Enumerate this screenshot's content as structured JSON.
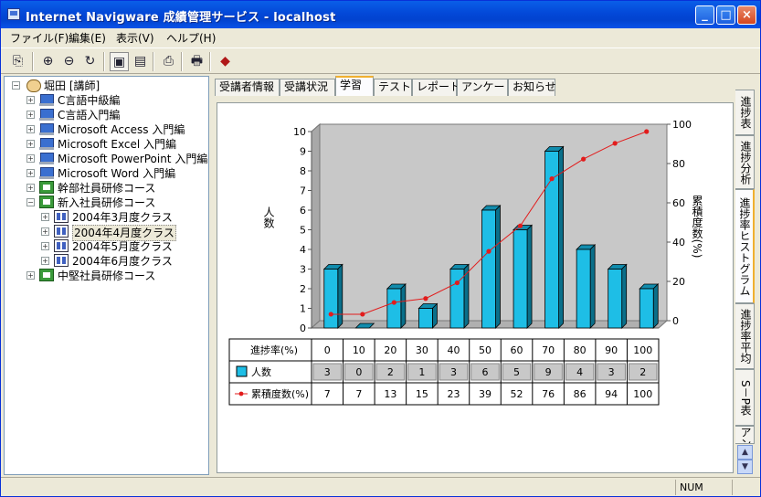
{
  "window": {
    "title": "Internet Navigware 成績管理サービス - localhost",
    "buttons": {
      "minimize": "_",
      "maximize": "□",
      "close": "×"
    }
  },
  "menu": [
    "ファイル(F)",
    "編集(E)",
    "表示(V)",
    "ヘルプ(H)"
  ],
  "toolbar": {
    "icons": [
      "connect-icon",
      "zoom-in-icon",
      "zoom-out-icon",
      "refresh-icon",
      "view-mode-a-icon",
      "view-mode-b-icon",
      "report-icon",
      "print-icon",
      "book-icon"
    ]
  },
  "tree": {
    "root": "堀田 [講師]",
    "items": [
      {
        "label": "C言語中級編",
        "type": "course",
        "expander": "+"
      },
      {
        "label": "C言語入門編",
        "type": "course",
        "expander": "+"
      },
      {
        "label": "Microsoft Access 入門編",
        "type": "course",
        "expander": "+"
      },
      {
        "label": "Microsoft Excel 入門編",
        "type": "course",
        "expander": "+"
      },
      {
        "label": "Microsoft PowerPoint 入門編",
        "type": "course",
        "expander": "+"
      },
      {
        "label": "Microsoft Word 入門編",
        "type": "course",
        "expander": "+"
      },
      {
        "label": "幹部社員研修コース",
        "type": "group",
        "expander": "+"
      },
      {
        "label": "新入社員研修コース",
        "type": "group",
        "expander": "−"
      },
      {
        "label": "2004年3月度クラス",
        "type": "class",
        "expander": "+"
      },
      {
        "label": "2004年4月度クラス",
        "type": "class",
        "expander": "+",
        "selected": true
      },
      {
        "label": "2004年5月度クラス",
        "type": "class",
        "expander": "+"
      },
      {
        "label": "2004年6月度クラス",
        "type": "class",
        "expander": "+"
      },
      {
        "label": "中堅社員研修コース",
        "type": "group",
        "expander": "+"
      }
    ]
  },
  "tabs": [
    "受講者情報",
    "受講状況",
    "学習",
    "テスト",
    "レポート",
    "アンケート",
    "お知らせ"
  ],
  "active_tab": "学習",
  "side_tabs": [
    "進捗表",
    "進捗分析",
    "進捗率ヒストグラム",
    "進捗率平均",
    "S－P表",
    "アン"
  ],
  "active_side_tab": "進捗率ヒストグラム",
  "status": {
    "indicator": "NUM"
  },
  "chart_data": {
    "type": "bar",
    "xlabel": "進捗率(%)",
    "categories": [
      "0",
      "10",
      "20",
      "30",
      "40",
      "50",
      "60",
      "70",
      "80",
      "90",
      "100"
    ],
    "series": [
      {
        "name": "人数",
        "type": "bar",
        "axis": "left",
        "color": "#1ebee6",
        "values": [
          3,
          0,
          2,
          1,
          3,
          6,
          5,
          9,
          4,
          3,
          2
        ]
      },
      {
        "name": "累積度数(%)",
        "type": "line",
        "axis": "right",
        "color": "#e21c1c",
        "values": [
          7,
          7,
          13,
          15,
          23,
          39,
          52,
          76,
          86,
          94,
          100
        ]
      }
    ],
    "ylabel": "人数",
    "y2label": "累積度数(%)",
    "ylim": [
      0,
      10
    ],
    "yticks": [
      0,
      1,
      2,
      3,
      4,
      5,
      6,
      7,
      8,
      9,
      10
    ],
    "y2lim": [
      0,
      100
    ],
    "y2ticks": [
      0,
      20,
      40,
      60,
      80,
      100
    ],
    "grid": false,
    "legend": "data-table"
  }
}
